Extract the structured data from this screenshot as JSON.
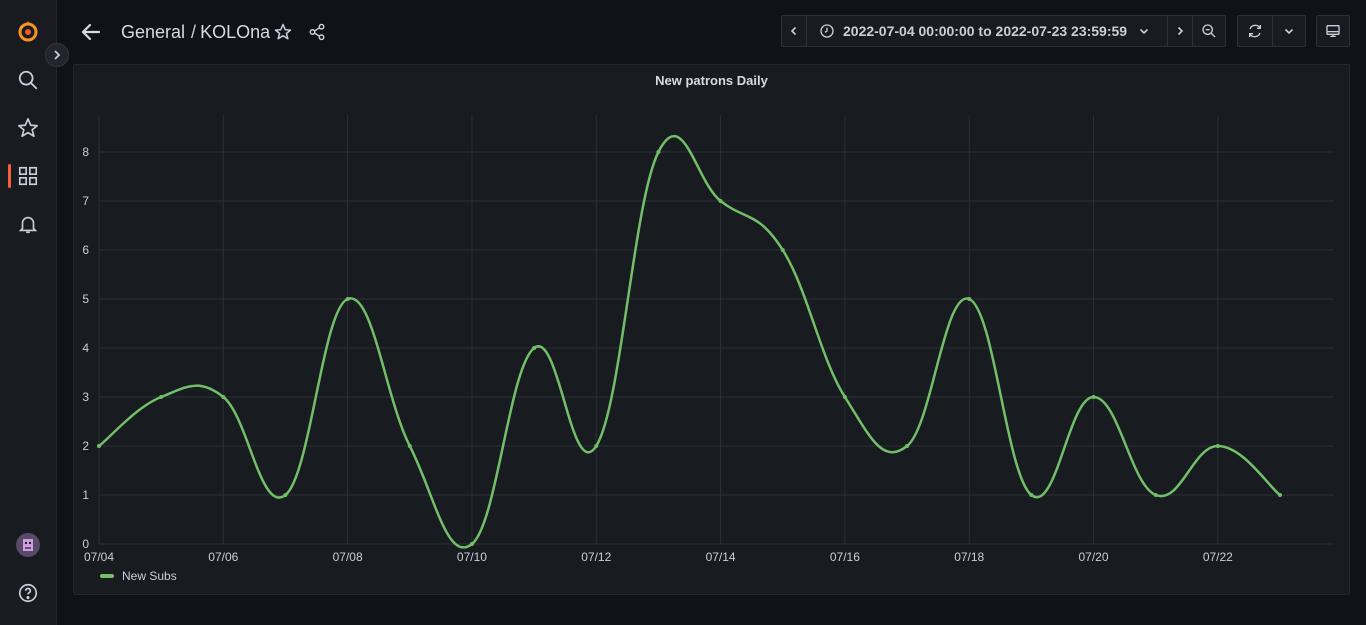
{
  "breadcrumb": {
    "folder": "General",
    "separator": "/",
    "dashboard": "KOLOna"
  },
  "time_picker": {
    "range": "2022-07-04 00:00:00 to 2022-07-23 23:59:59"
  },
  "colors": {
    "accent": "#f55f3e",
    "series": "#73bf69",
    "background": "#111217",
    "panel": "#181b1f"
  },
  "sidebar": {
    "icons": [
      "grafana-logo-icon",
      "search-icon",
      "star-icon",
      "dashboards-icon",
      "bell-icon",
      "avatar",
      "help-icon"
    ]
  },
  "chart_data": {
    "type": "line",
    "title": "New patrons Daily",
    "xlabel": "",
    "ylabel": "",
    "x": [
      "07/04",
      "07/05",
      "07/06",
      "07/07",
      "07/08",
      "07/09",
      "07/10",
      "07/11",
      "07/12",
      "07/13",
      "07/14",
      "07/15",
      "07/16",
      "07/17",
      "07/18",
      "07/19",
      "07/20",
      "07/21",
      "07/22",
      "07/23"
    ],
    "x_tick_labels": [
      "07/04",
      "07/06",
      "07/08",
      "07/10",
      "07/12",
      "07/14",
      "07/16",
      "07/18",
      "07/20",
      "07/22"
    ],
    "series": [
      {
        "name": "New Subs",
        "color": "#73bf69",
        "values": [
          2,
          3,
          3,
          1,
          5,
          2,
          0,
          4,
          2,
          8,
          7,
          6,
          3,
          2,
          5,
          1,
          3,
          1,
          2,
          1
        ]
      }
    ],
    "ylim": [
      0,
      8
    ],
    "y_ticks": [
      "0",
      "1",
      "2",
      "3",
      "4",
      "5",
      "6",
      "7",
      "8"
    ],
    "grid": true,
    "legend_placement": "bottom-left"
  }
}
